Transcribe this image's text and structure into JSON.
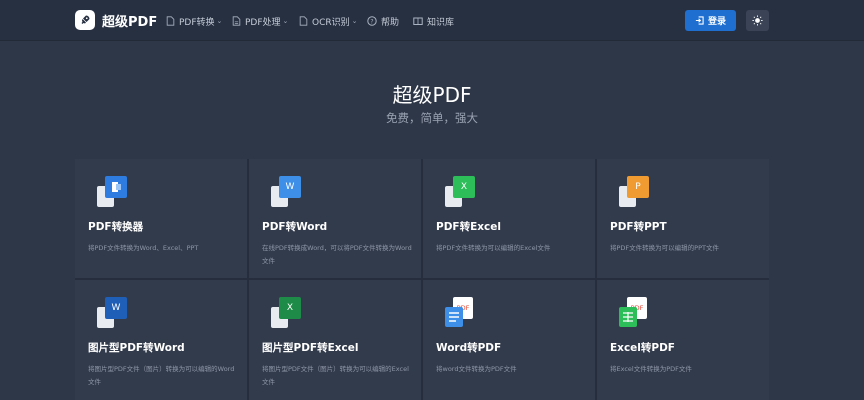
{
  "header": {
    "brand": "超级PDF",
    "nav": [
      {
        "label": "PDF转换",
        "has_caret": true
      },
      {
        "label": "PDF处理",
        "has_caret": true
      },
      {
        "label": "OCR识别",
        "has_caret": true
      },
      {
        "label": "帮助",
        "has_caret": false
      },
      {
        "label": "知识库",
        "has_caret": false
      }
    ],
    "login_label": "登录"
  },
  "hero": {
    "title": "超级PDF",
    "subtitle": "免费，简单，强大"
  },
  "cards": [
    {
      "title": "PDF转换器",
      "desc": "将PDF文件转换为Word、Excel、PPT",
      "badge_text": "",
      "badge_color": "#2f7ce0",
      "icon": "pdf-converter-icon"
    },
    {
      "title": "PDF转Word",
      "desc": "在线PDF转换成Word，可以将PDF文件转换为Word文件",
      "badge_text": "W",
      "badge_color": "#3d8fe8",
      "icon": "word-icon"
    },
    {
      "title": "PDF转Excel",
      "desc": "将PDF文件转换为可以编辑的Excel文件",
      "badge_text": "X",
      "badge_color": "#2dbe5a",
      "icon": "excel-icon"
    },
    {
      "title": "PDF转PPT",
      "desc": "将PDF文件转换为可以编辑的PPT文件",
      "badge_text": "P",
      "badge_color": "#f09b32",
      "icon": "ppt-icon"
    },
    {
      "title": "图片型PDF转Word",
      "desc": "将图片型PDF文件（图片）转换为可以编辑的Word文件",
      "badge_text": "W",
      "badge_color": "#1f5fb8",
      "icon": "image-pdf-word-icon"
    },
    {
      "title": "图片型PDF转Excel",
      "desc": "将图片型PDF文件（图片）转换为可以编辑的Excel文件",
      "badge_text": "X",
      "badge_color": "#1e8c48",
      "icon": "image-pdf-excel-icon"
    },
    {
      "title": "Word转PDF",
      "desc": "将word文件转换为PDF文件",
      "badge_text": "PDF",
      "badge_color": "#3d8fe8",
      "icon": "word-to-pdf-icon"
    },
    {
      "title": "Excel转PDF",
      "desc": "将Excel文件转换为PDF文件",
      "badge_text": "PDF",
      "badge_color": "#2dbe5a",
      "icon": "excel-to-pdf-icon"
    }
  ],
  "colors": {
    "background": "#2e3748",
    "navbar": "#273041",
    "card": "#323b4c",
    "primary": "#1f6fd1"
  }
}
